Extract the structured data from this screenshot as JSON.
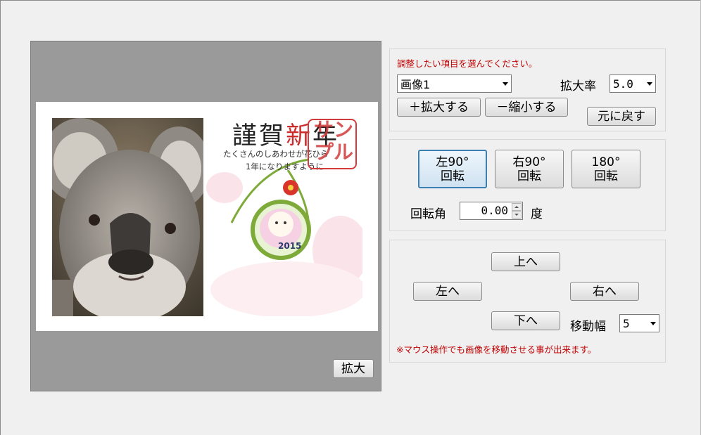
{
  "preview": {
    "card": {
      "title_black_1": "謹",
      "title_black_2": "賀",
      "title_red": "新",
      "title_black_3": "年",
      "message_line1": "たくさんのしあわせが花ひら",
      "message_line2": "1年になりますように",
      "stamp_text": "サンプル",
      "year": "2015"
    },
    "zoom_button": "拡大"
  },
  "adjust": {
    "instruction": "調整したい項目を選んでください。",
    "item_select": "画像1",
    "scale_label": "拡大率",
    "scale_select": "5.0",
    "enlarge_button": "＋拡大する",
    "shrink_button": "－縮小する",
    "reset_button": "元に戻す"
  },
  "rotate": {
    "left90_line1": "左90°",
    "left90_line2": "回転",
    "right90_line1": "右90°",
    "right90_line2": "回転",
    "r180_line1": "180°",
    "r180_line2": "回転",
    "angle_label": "回転角",
    "angle_value": "0.00",
    "angle_unit": "度"
  },
  "move": {
    "up_button": "上へ",
    "left_button": "左へ",
    "right_button": "右へ",
    "down_button": "下へ",
    "step_label": "移動幅",
    "step_select": "5",
    "note": "※マウス操作でも画像を移動させる事が出来ます。"
  },
  "colors": {
    "accent_red": "#cc2b2b",
    "note_red": "#c00000",
    "selected_border": "#3c7fb1"
  }
}
